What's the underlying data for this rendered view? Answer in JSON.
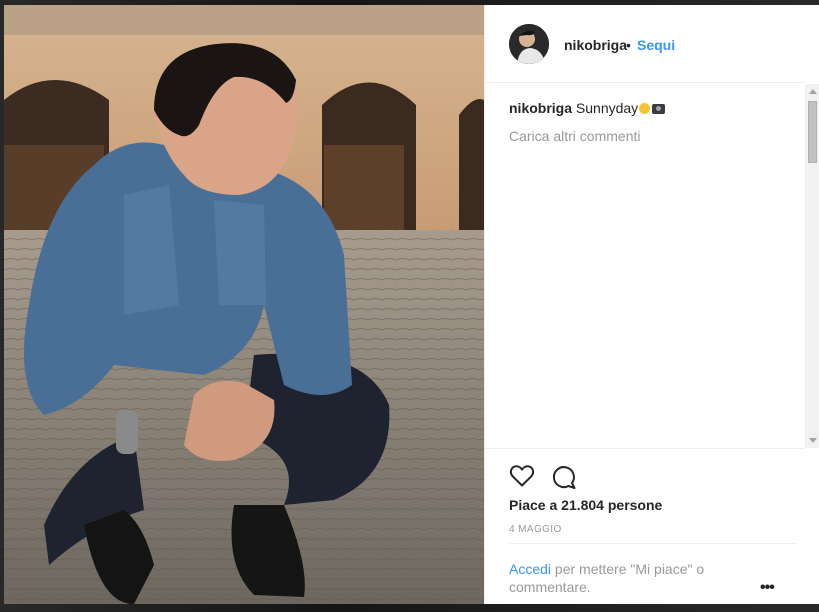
{
  "post": {
    "username": "nikobriga",
    "dot": "•",
    "follow_label": "Sequi",
    "caption_user": "nikobriga",
    "caption_text": "Sunnyday",
    "caption_emojis": [
      "sun-emoji",
      "camera-emoji"
    ],
    "load_more_label": "Carica altri commenti",
    "likes_text": "Piace a 21.804 persone",
    "date": "4 MAGGIO",
    "login_link": "Accedi",
    "login_rest": " per mettere \"Mi piace\" o commentare.",
    "more_label": "•••"
  },
  "icons": {
    "like": "heart-outline-icon",
    "comment": "comment-bubble-icon",
    "more": "more-options-icon"
  },
  "colors": {
    "link_blue": "#3897f0",
    "text": "#262626",
    "muted": "#999999"
  }
}
